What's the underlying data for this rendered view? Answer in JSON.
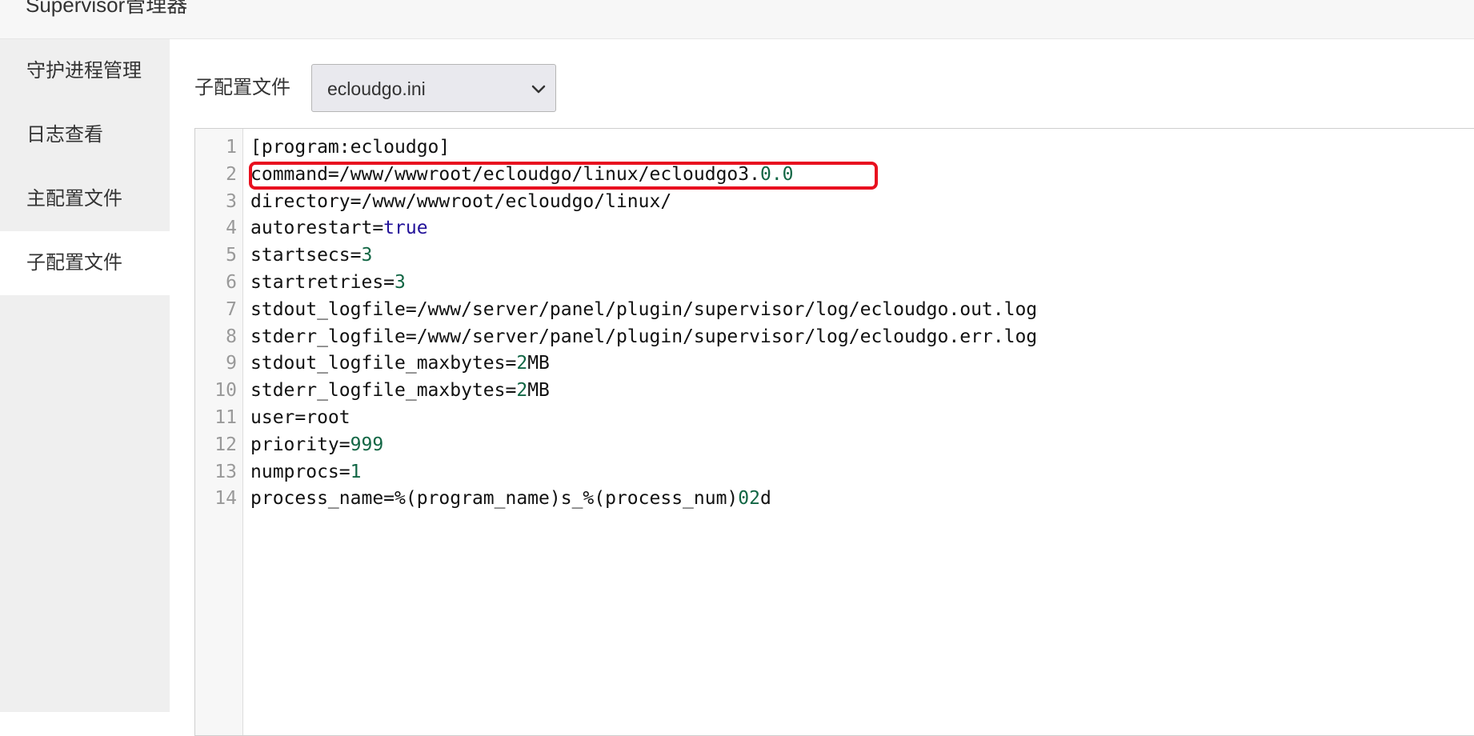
{
  "app": {
    "title": "Supervisor管理器"
  },
  "sidebar": {
    "items": [
      {
        "label": "守护进程管理",
        "active": false
      },
      {
        "label": "日志查看",
        "active": false
      },
      {
        "label": "主配置文件",
        "active": false
      },
      {
        "label": "子配置文件",
        "active": true
      }
    ]
  },
  "config": {
    "label": "子配置文件",
    "selected_file": "ecloudgo.ini",
    "chevron_icon": "chevron-down-icon"
  },
  "editor": {
    "lines": [
      {
        "n": "1",
        "parts": [
          {
            "t": "[program:ecloudgo]"
          }
        ]
      },
      {
        "n": "2",
        "parts": [
          {
            "t": "command=/www/wwwroot/ecloudgo/linux/ecloudgo3."
          },
          {
            "t": "0.0",
            "c": "num"
          }
        ]
      },
      {
        "n": "3",
        "parts": [
          {
            "t": "directory=/www/wwwroot/ecloudgo/linux/"
          }
        ]
      },
      {
        "n": "4",
        "parts": [
          {
            "t": "autorestart="
          },
          {
            "t": "true",
            "c": "atom"
          }
        ]
      },
      {
        "n": "5",
        "parts": [
          {
            "t": "startsecs="
          },
          {
            "t": "3",
            "c": "num"
          }
        ]
      },
      {
        "n": "6",
        "parts": [
          {
            "t": "startretries="
          },
          {
            "t": "3",
            "c": "num"
          }
        ]
      },
      {
        "n": "7",
        "parts": [
          {
            "t": "stdout_logfile=/www/server/panel/plugin/supervisor/log/ecloudgo.out.log"
          }
        ]
      },
      {
        "n": "8",
        "parts": [
          {
            "t": "stderr_logfile=/www/server/panel/plugin/supervisor/log/ecloudgo.err.log"
          }
        ]
      },
      {
        "n": "9",
        "parts": [
          {
            "t": "stdout_logfile_maxbytes="
          },
          {
            "t": "2",
            "c": "num"
          },
          {
            "t": "MB"
          }
        ]
      },
      {
        "n": "10",
        "parts": [
          {
            "t": "stderr_logfile_maxbytes="
          },
          {
            "t": "2",
            "c": "num"
          },
          {
            "t": "MB"
          }
        ]
      },
      {
        "n": "11",
        "parts": [
          {
            "t": "user=root"
          }
        ]
      },
      {
        "n": "12",
        "parts": [
          {
            "t": "priority="
          },
          {
            "t": "999",
            "c": "num"
          }
        ]
      },
      {
        "n": "13",
        "parts": [
          {
            "t": "numprocs="
          },
          {
            "t": "1",
            "c": "num"
          }
        ]
      },
      {
        "n": "14",
        "parts": [
          {
            "t": "process_name=%(program_name)s_%(process_num)"
          },
          {
            "t": "02",
            "c": "num"
          },
          {
            "t": "d"
          }
        ]
      }
    ],
    "highlighted_line": "2",
    "colors": {
      "number": "#116644",
      "atom": "#221199",
      "highlight_box": "#e8101f"
    }
  }
}
